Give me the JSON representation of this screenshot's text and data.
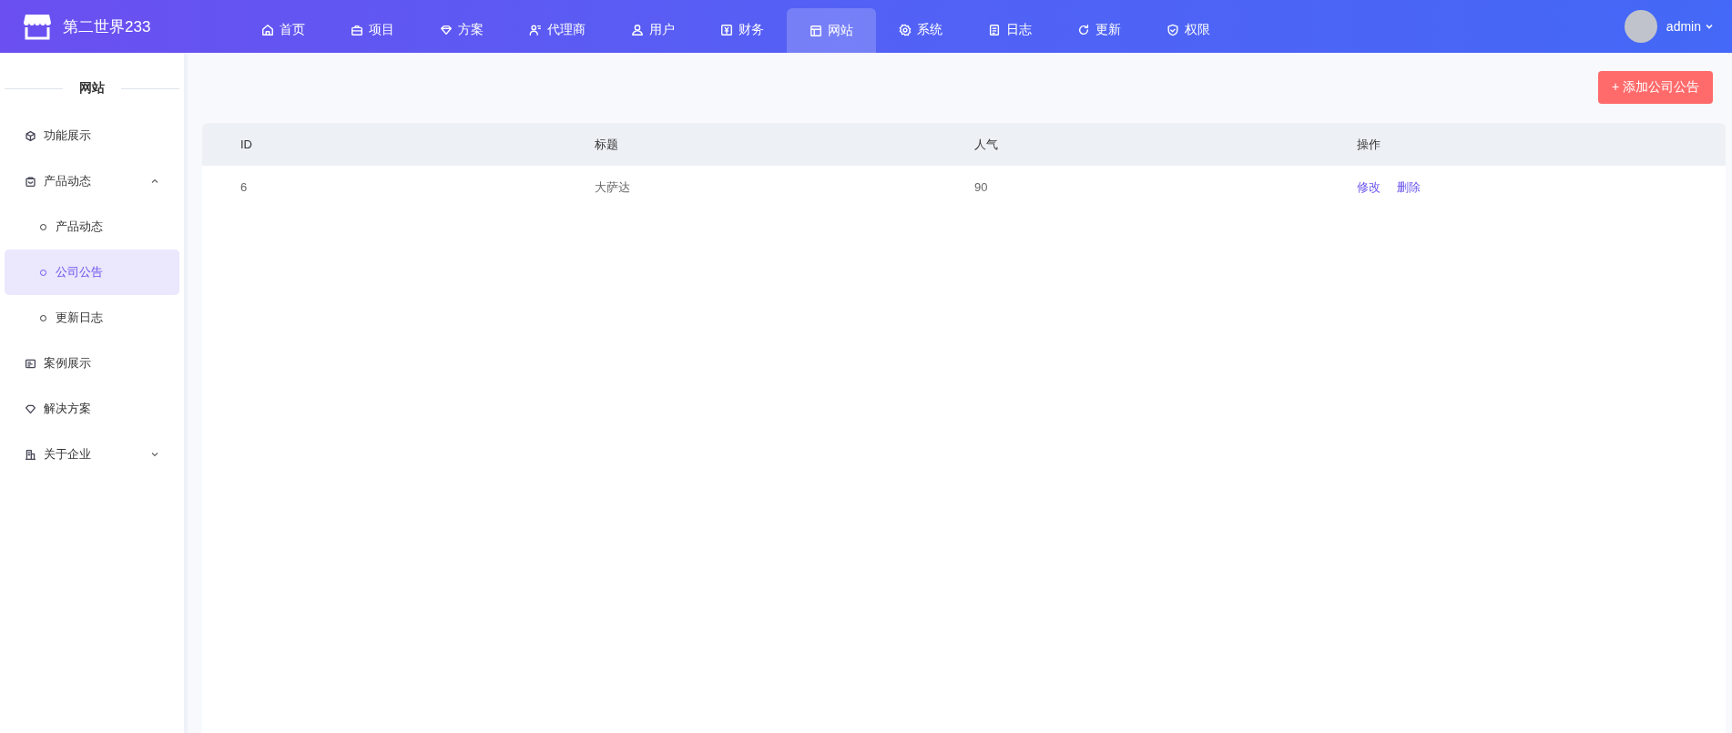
{
  "header": {
    "brand": "第二世界233",
    "nav": [
      {
        "label": "首页",
        "selected": false
      },
      {
        "label": "项目",
        "selected": false
      },
      {
        "label": "方案",
        "selected": false
      },
      {
        "label": "代理商",
        "selected": false
      },
      {
        "label": "用户",
        "selected": false
      },
      {
        "label": "财务",
        "selected": false
      },
      {
        "label": "网站",
        "selected": true
      },
      {
        "label": "系统",
        "selected": false
      },
      {
        "label": "日志",
        "selected": false
      },
      {
        "label": "更新",
        "selected": false
      },
      {
        "label": "权限",
        "selected": false
      }
    ],
    "user": {
      "name": "admin"
    }
  },
  "sidebar": {
    "title": "网站",
    "items": [
      {
        "kind": "item",
        "label": "功能展示",
        "selected": false
      },
      {
        "kind": "group",
        "label": "产品动态",
        "expanded": true,
        "children": [
          {
            "label": "产品动态",
            "selected": false
          },
          {
            "label": "公司公告",
            "selected": true
          },
          {
            "label": "更新日志",
            "selected": false
          }
        ]
      },
      {
        "kind": "item",
        "label": "案例展示",
        "selected": false
      },
      {
        "kind": "item",
        "label": "解决方案",
        "selected": false
      },
      {
        "kind": "group",
        "label": "关于企业",
        "expanded": false
      }
    ]
  },
  "toolbar": {
    "add_button": "+ 添加公司公告"
  },
  "table": {
    "columns": [
      "ID",
      "标题",
      "人气",
      "操作"
    ],
    "rows": [
      {
        "id": "6",
        "title": "大萨达",
        "popularity": "90",
        "actions": [
          "修改",
          "删除"
        ]
      }
    ]
  }
}
